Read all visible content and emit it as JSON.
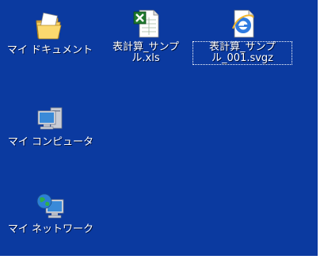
{
  "desktop": {
    "background_color": "#0b3aa0",
    "icons": [
      {
        "label_lines": [
          "マイ ドキュメント"
        ],
        "icon": "my-documents-folder-icon"
      },
      {
        "label_lines": [
          "表計算_サンプ",
          "ル.xls"
        ],
        "icon": "excel-file-icon"
      },
      {
        "label_lines": [
          "表計算_サンプ",
          "ル_001.svgz"
        ],
        "icon": "internet-explorer-file-icon",
        "selected": true
      },
      {
        "label_lines": [
          "マイ コンピュータ"
        ],
        "icon": "my-computer-icon"
      },
      {
        "label_lines": [
          "マイ ネットワーク"
        ],
        "icon": "my-network-icon"
      }
    ]
  }
}
